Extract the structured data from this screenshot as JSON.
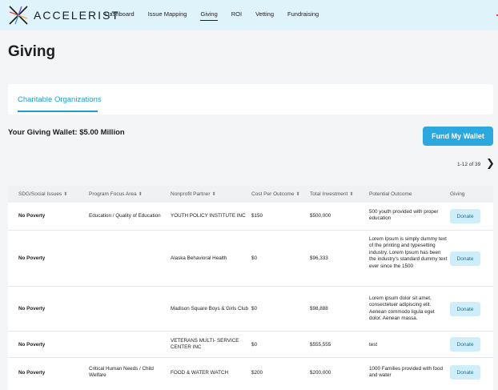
{
  "header": {
    "brand": "ACCELERIST",
    "nav": [
      {
        "label": "Dashboard",
        "active": false
      },
      {
        "label": "Issue Mapping",
        "active": false
      },
      {
        "label": "Giving",
        "active": true
      },
      {
        "label": "ROI",
        "active": false
      },
      {
        "label": "Vetting",
        "active": false
      },
      {
        "label": "Fundraising",
        "active": false
      }
    ]
  },
  "page": {
    "title": "Giving"
  },
  "tabs": [
    {
      "label": "Charitable Organizations",
      "active": true
    }
  ],
  "wallet": {
    "text": "Your Giving Wallet: $5.00 Million",
    "button_label": "Fund My Wallet"
  },
  "pagination": {
    "text": "1-12 of 39"
  },
  "table": {
    "columns": [
      "SDG/Social Issues",
      "Program Focus Area",
      "Nonprofit Partner",
      "Cost Per Outcome",
      "Total Investment",
      "Potential Outcome",
      "Giving"
    ],
    "rows": [
      {
        "sdg": "No Poverty",
        "focus": "Education / Quality of Education",
        "partner": "YOUTH POLICY INSTITUTE INC",
        "cost": "$150",
        "total": "$500,000",
        "outcome": "500 youth provided with proper education",
        "action": "Donate"
      },
      {
        "sdg": "No Poverty",
        "focus": "",
        "partner": "Alaska Behavioral Health",
        "cost": "$0",
        "total": "$96,333",
        "outcome": "Lorem Ipsum is simply dummy text of the printing and typesetting industry. Lorem Ipsum has been the industry's standard dummy text ever since the 1500",
        "action": "Donate"
      },
      {
        "sdg": "No Poverty",
        "focus": "",
        "partner": "Madison Square Boys & Girls Club",
        "cost": "$0",
        "total": "$98,888",
        "outcome": "Lorem ipsum dolor sit amet, consectetuer adipiscing elit. Aenean commodo ligula eget dolor. Aenean massa.",
        "action": "Donate"
      },
      {
        "sdg": "No Poverty",
        "focus": "",
        "partner": "VETERANS MULTI- SERVICE CENTER INC",
        "cost": "$0",
        "total": "$555,555",
        "outcome": "test",
        "action": "Donate"
      },
      {
        "sdg": "No Poverty",
        "focus": "Critical Human Needs / Child Welfare",
        "partner": "FOOD & WATER WATCH",
        "cost": "$200",
        "total": "$200,000",
        "outcome": "1000 Families provided with food and water",
        "action": "Donate"
      }
    ]
  },
  "colors": {
    "accent": "#2aa8df",
    "header_bg": "#dff3fb",
    "donate_bg": "#cfeefb"
  }
}
